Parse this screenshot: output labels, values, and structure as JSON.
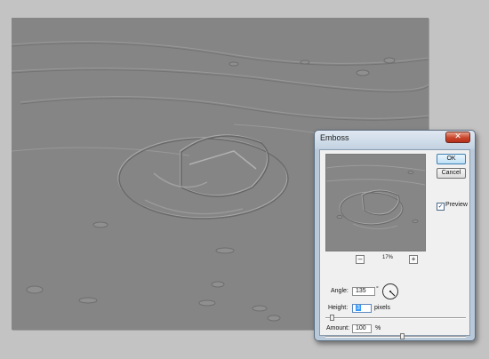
{
  "dialog": {
    "title": "Emboss",
    "close_glyph": "✕",
    "ok_label": "OK",
    "cancel_label": "Cancel",
    "preview_label": "Preview",
    "preview_checked": true,
    "zoom_out_glyph": "–",
    "zoom_in_glyph": "+",
    "zoom_value": "17%",
    "angle": {
      "label": "Angle:",
      "value": "135",
      "unit": "°"
    },
    "height": {
      "label": "Height:",
      "value": "3",
      "unit": "pixels"
    },
    "amount": {
      "label": "Amount:",
      "value": "100",
      "unit": "%"
    },
    "height_slider_fraction": 0.03,
    "amount_slider_fraction": 0.55
  },
  "colors": {
    "canvas_gray": "#858585",
    "workspace_gray": "#c3c3c3",
    "dialog_frame": "#b9c9d9",
    "close_red": "#c8452c"
  }
}
